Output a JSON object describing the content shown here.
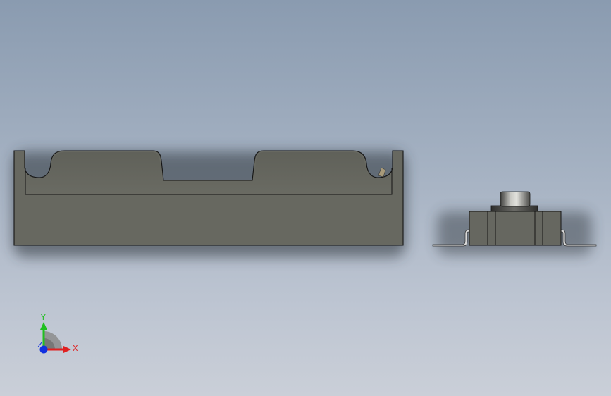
{
  "viewport": {
    "background_top": "#8a9bb0",
    "background_bottom": "#cacfd8"
  },
  "parts": {
    "front_view_body_color": "#676860",
    "side_view_body_color": "#666760",
    "pin_color": "#c8c8c8"
  },
  "triad": {
    "x_label": "X",
    "y_label": "Y",
    "z_label": "Z",
    "x_color": "#e02020",
    "y_color": "#20c020",
    "z_color": "#1030e0"
  }
}
